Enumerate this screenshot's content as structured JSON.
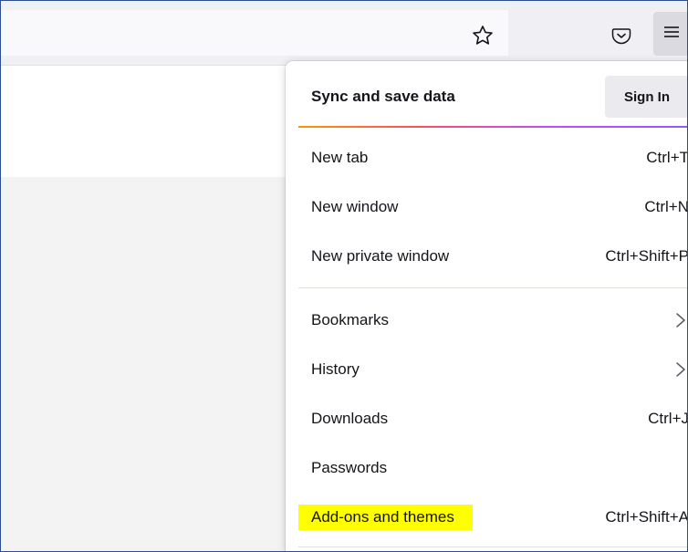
{
  "toolbar": {
    "icons": {
      "bookmark_star": "star-outline-icon",
      "pocket": "pocket-icon",
      "app_menu": "hamburger-menu-icon"
    }
  },
  "menu": {
    "sync": {
      "title": "Sync and save data",
      "button": "Sign In"
    },
    "items": [
      {
        "label": "New tab",
        "shortcut": "Ctrl+T"
      },
      {
        "label": "New window",
        "shortcut": "Ctrl+N"
      },
      {
        "label": "New private window",
        "shortcut": "Ctrl+Shift+P"
      },
      {
        "label": "Bookmarks",
        "submenu": "chevron-right-icon"
      },
      {
        "label": "History",
        "submenu": "chevron-right-icon"
      },
      {
        "label": "Downloads",
        "shortcut": "Ctrl+J"
      },
      {
        "label": "Passwords"
      },
      {
        "label": "Add-ons and themes",
        "shortcut": "Ctrl+Shift+A",
        "highlighted": true
      }
    ]
  },
  "colors": {
    "highlight": "#ffff00",
    "toolbar_bg": "#f0f0f4",
    "border": "#2b4f8f"
  }
}
